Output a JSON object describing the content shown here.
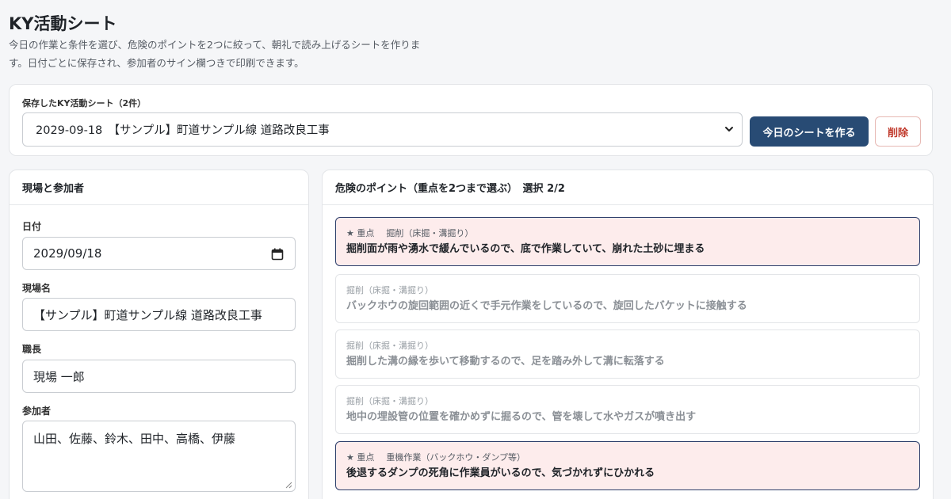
{
  "header": {
    "title": "KY活動シート",
    "description_line1": "今日の作業と条件を選び、危険のポイントを2つに絞って、朝礼で読み上げるシートを作りま",
    "description_line2": "す。日付ごとに保存され、参加者のサイン欄つきで印刷できます。"
  },
  "saved": {
    "label": "保存したKY活動シート（2件）",
    "selected": "2029-09-18　【サンプル】町道サンプル線 道路改良工事",
    "create_button": "今日のシートを作る",
    "delete_button": "削除"
  },
  "site": {
    "title": "現場と参加者",
    "date_label": "日付",
    "date_value": "2029/09/18",
    "name_label": "現場名",
    "name_value": "【サンプル】町道サンプル線 道路改良工事",
    "foreman_label": "職長",
    "foreman_value": "現場 一郎",
    "participants_label": "参加者",
    "participants_value": "山田、佐藤、鈴木、田中、高橋、伊藤"
  },
  "hazards": {
    "title": "危険のポイント（重点を2つまで選ぶ）　選択 2/2",
    "star_label": "★ 重点",
    "items": [
      {
        "category": "掘削（床掘・溝掘り）",
        "text": "掘削面が雨や湧水で緩んでいるので、底で作業していて、崩れた土砂に埋まる",
        "selected": true
      },
      {
        "category": "掘削（床掘・溝掘り）",
        "text": "バックホウの旋回範囲の近くで手元作業をしているので、旋回したバケットに接触する",
        "selected": false
      },
      {
        "category": "掘削（床掘・溝掘り）",
        "text": "掘削した溝の縁を歩いて移動するので、足を踏み外して溝に転落する",
        "selected": false
      },
      {
        "category": "掘削（床掘・溝掘り）",
        "text": "地中の埋設管の位置を確かめずに掘るので、管を壊して水やガスが噴き出す",
        "selected": false
      },
      {
        "category": "重機作業（バックホウ・ダンプ等）",
        "text": "後退するダンプの死角に作業員がいるので、気づかれずにひかれる",
        "selected": true
      }
    ]
  },
  "colors": {
    "primary": "#284b74",
    "danger": "#c0392b",
    "selected_bg": "#fdecec",
    "selected_border": "#2d3f6b"
  }
}
